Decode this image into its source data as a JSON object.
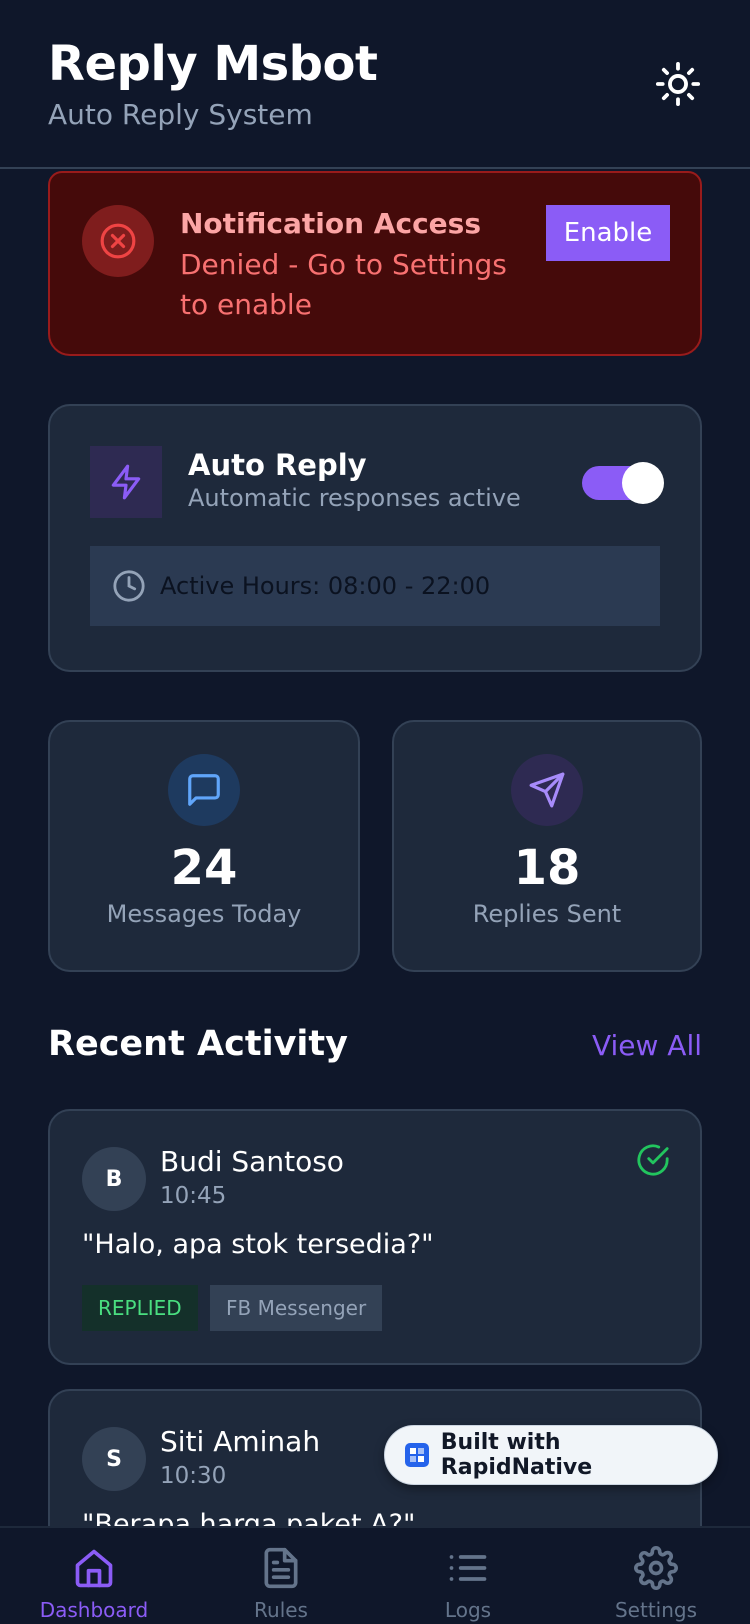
{
  "header": {
    "title": "Reply Msbot",
    "subtitle": "Auto Reply System",
    "theme_icon": "sun-icon"
  },
  "notification": {
    "title": "Notification Access",
    "description": "Denied - Go to Settings to enable",
    "button_label": "Enable",
    "icon": "x-circle-icon"
  },
  "auto_reply": {
    "title": "Auto Reply",
    "subtitle": "Automatic responses active",
    "enabled": true,
    "hours_text": "Active Hours: 08:00 - 22:00"
  },
  "stats": [
    {
      "value": "24",
      "label": "Messages Today",
      "icon": "message-square-icon"
    },
    {
      "value": "18",
      "label": "Replies Sent",
      "icon": "send-icon"
    }
  ],
  "recent_activity": {
    "title": "Recent Activity",
    "view_all": "View All",
    "items": [
      {
        "initial": "B",
        "name": "Budi Santoso",
        "time": "10:45",
        "message": "\"Halo, apa stok tersedia?\"",
        "status": "REPLIED",
        "source": "FB Messenger"
      },
      {
        "initial": "S",
        "name": "Siti Aminah",
        "time": "10:30",
        "message": "\"Berapa harga paket A?\""
      }
    ]
  },
  "badge": {
    "text": "Built with RapidNative"
  },
  "tabs": [
    {
      "label": "Dashboard",
      "icon": "home-icon",
      "active": true
    },
    {
      "label": "Rules",
      "icon": "file-text-icon",
      "active": false
    },
    {
      "label": "Logs",
      "icon": "list-icon",
      "active": false
    },
    {
      "label": "Settings",
      "icon": "settings-icon",
      "active": false
    }
  ],
  "colors": {
    "background": "#0f172a",
    "card": "#1e293b",
    "accent": "#8b5cf6",
    "danger": "#f87171",
    "success": "#4ade80"
  }
}
